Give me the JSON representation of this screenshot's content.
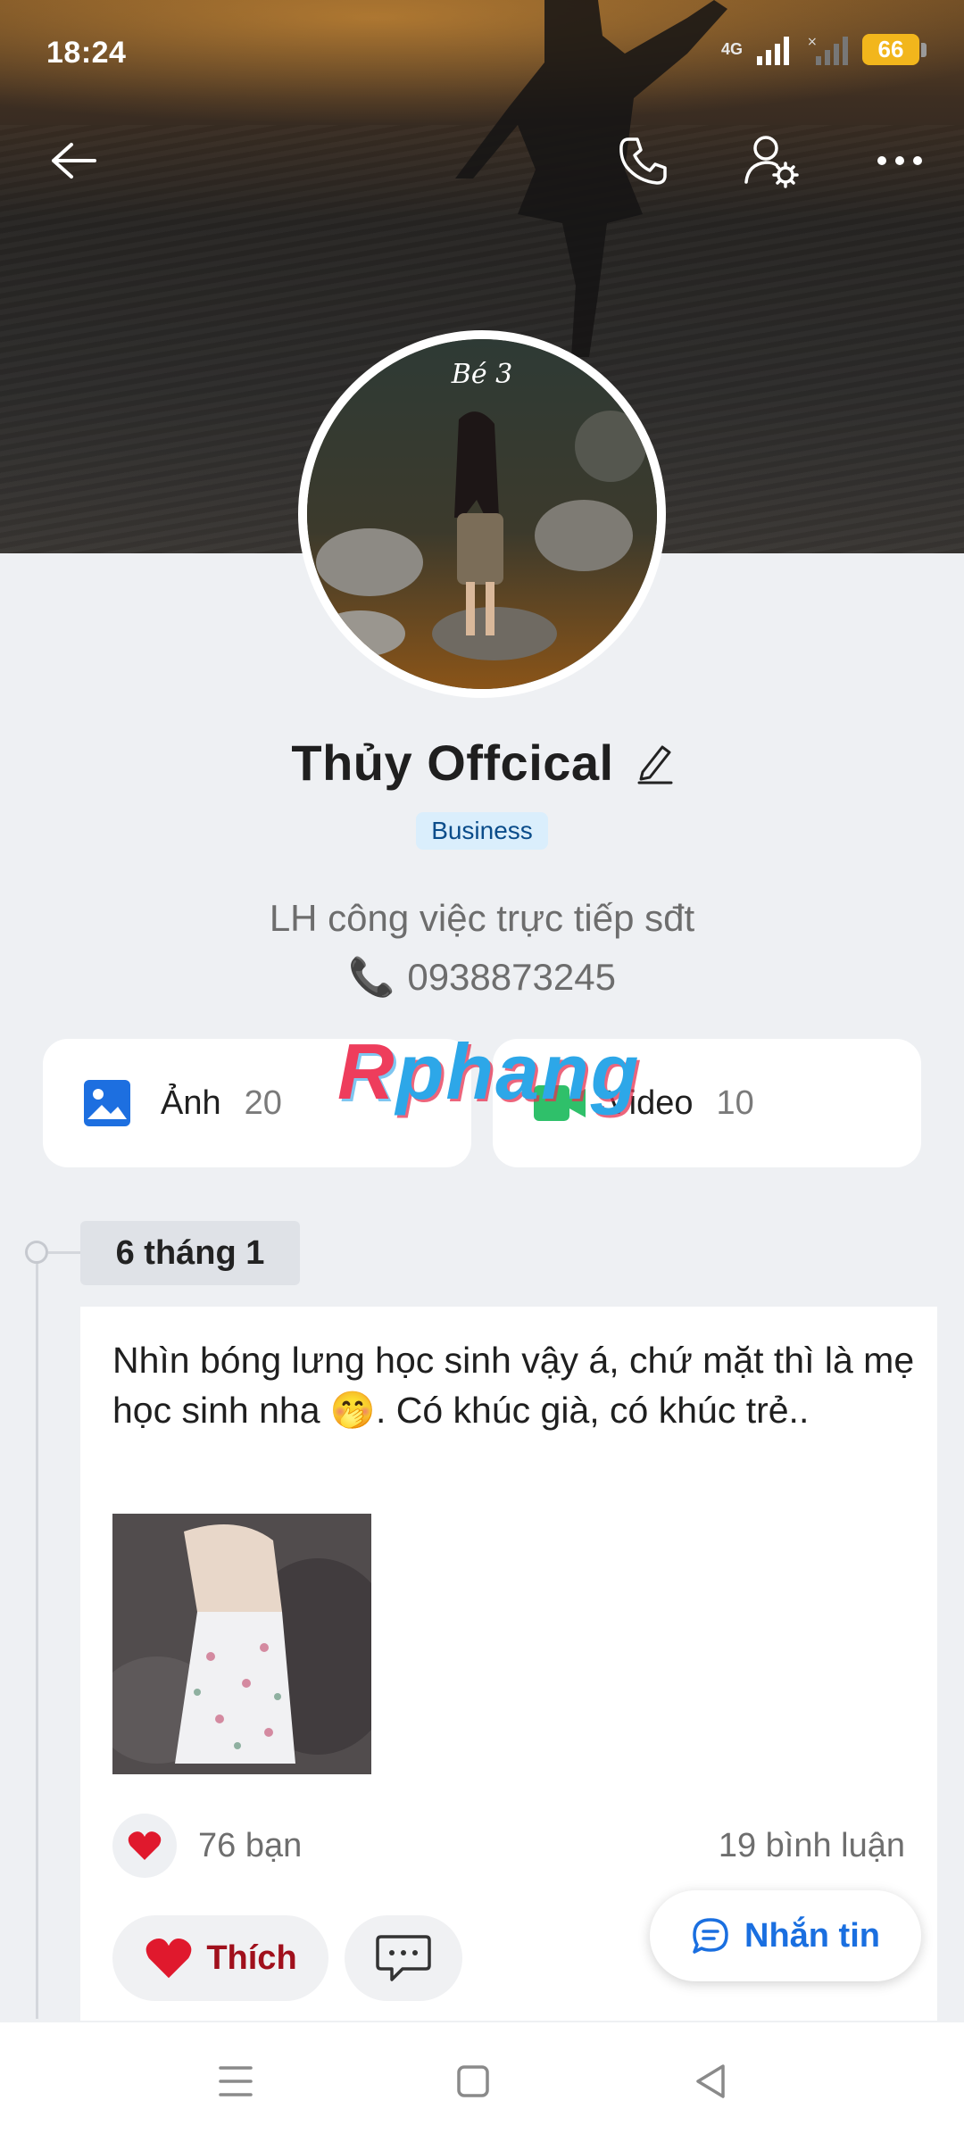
{
  "status": {
    "time": "18:24",
    "network": "4G",
    "battery": "66"
  },
  "topbar": {
    "back_icon": "arrow-left-icon",
    "call_icon": "phone-icon",
    "settings_icon": "user-gear-icon",
    "more_icon": "more-horizontal-icon"
  },
  "avatar": {
    "overlay_text": "Bé 3"
  },
  "profile": {
    "name": "Thủy Offcical",
    "badge": "Business",
    "bio_line1": "LH công việc trực tiếp sđt",
    "phone_emoji": "📞",
    "phone": "0938873245"
  },
  "media": {
    "photos_label": "Ảnh",
    "photos_count": "20",
    "videos_label": "Video",
    "videos_count": "10"
  },
  "watermark": {
    "prefix": "R",
    "rest": "phang"
  },
  "timeline": {
    "date": "6 tháng 1",
    "post": {
      "text": "Nhìn bóng lưng học sinh vậy á, chứ mặt thì là mẹ học sinh nha 🤭.  Có khúc già, có khúc trẻ..",
      "likes": "76 bạn",
      "comments": "19 bình luận",
      "like_label": "Thích"
    }
  },
  "actions": {
    "message_label": "Nhắn tin"
  },
  "colors": {
    "accent_blue": "#1a6fe0",
    "like_red": "#a0101c",
    "badge_bg": "#daeefc",
    "battery": "#f2b61c"
  }
}
